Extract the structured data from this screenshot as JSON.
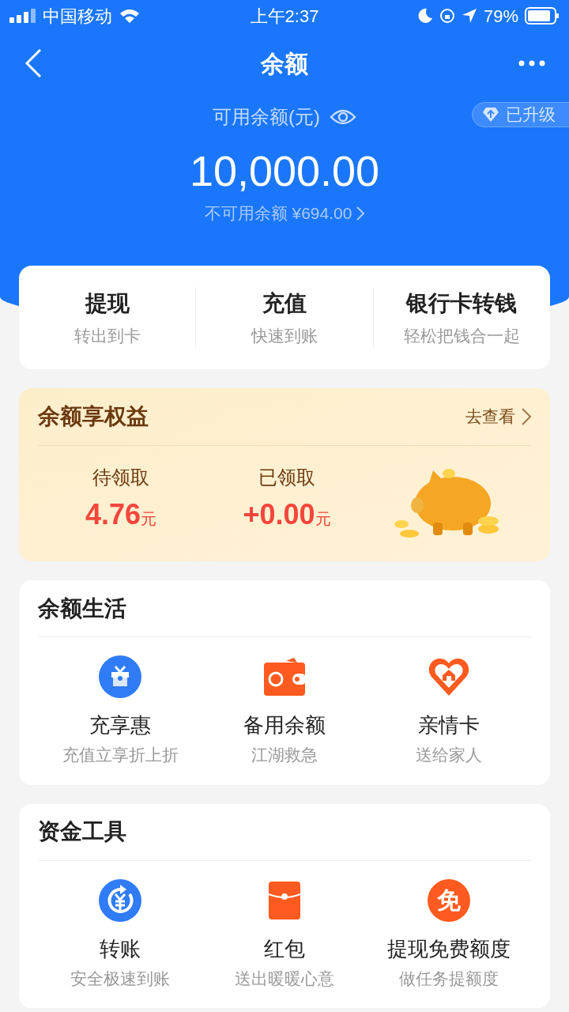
{
  "status_bar": {
    "carrier": "中国移动",
    "time": "上午2:37",
    "battery": "79%"
  },
  "nav": {
    "title": "余额"
  },
  "balance": {
    "label": "可用余额(元)",
    "badge": "已升级",
    "amount": "10,000.00",
    "unavailable": "不可用余额 ¥694.00"
  },
  "actions": [
    {
      "title": "提现",
      "subtitle": "转出到卡"
    },
    {
      "title": "充值",
      "subtitle": "快速到账"
    },
    {
      "title": "银行卡转钱",
      "subtitle": "轻松把钱合一起"
    }
  ],
  "benefits": {
    "title": "余额享权益",
    "link": "去查看",
    "stats": [
      {
        "label": "待领取",
        "value": "4.76",
        "unit": "元"
      },
      {
        "label": "已领取",
        "value": "+0.00",
        "unit": "元"
      }
    ]
  },
  "sections": [
    {
      "title": "余额生活",
      "items": [
        {
          "kind": "gift",
          "title": "充享惠",
          "subtitle": "充值立享折上折"
        },
        {
          "kind": "wallet",
          "title": "备用余额",
          "subtitle": "江湖救急"
        },
        {
          "kind": "heart",
          "title": "亲情卡",
          "subtitle": "送给家人"
        }
      ]
    },
    {
      "title": "资金工具",
      "items": [
        {
          "kind": "transfer",
          "title": "转账",
          "subtitle": "安全极速到账"
        },
        {
          "kind": "envelope",
          "title": "红包",
          "subtitle": "送出暖暖心意"
        },
        {
          "kind": "glyph",
          "glyph": "免",
          "title": "提现免费额度",
          "subtitle": "做任务提额度"
        }
      ]
    }
  ]
}
